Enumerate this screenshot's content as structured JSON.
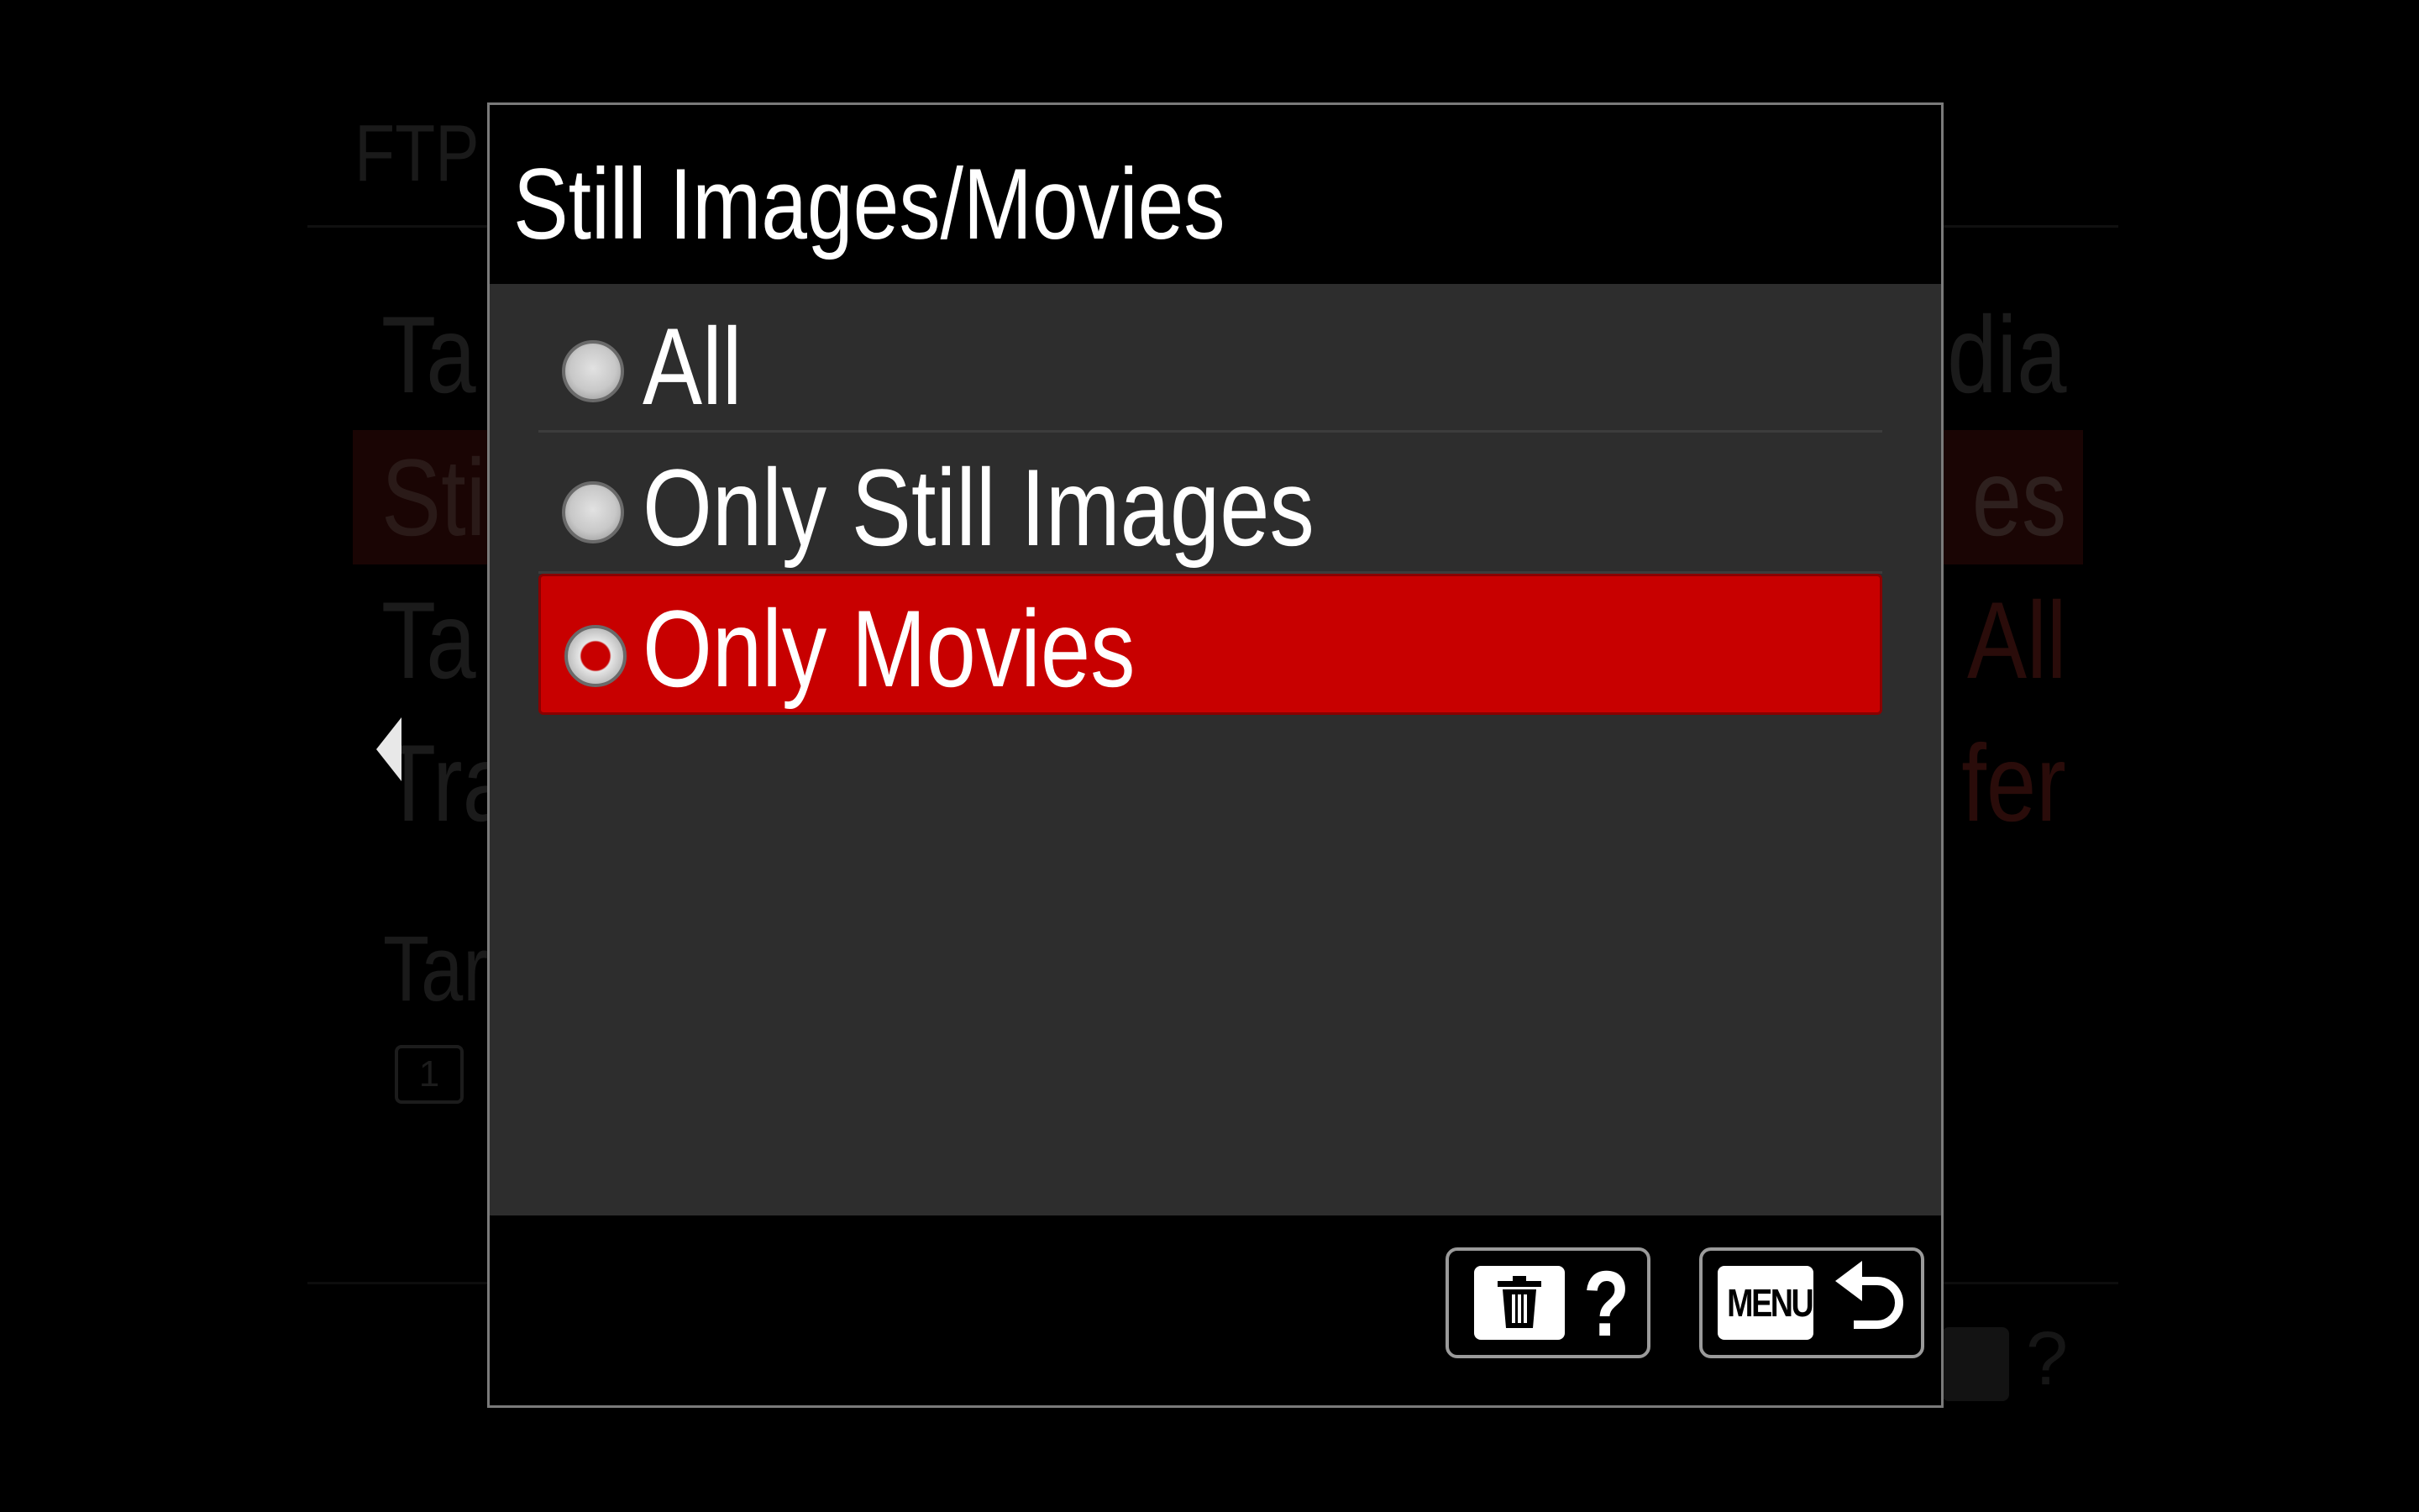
{
  "background_menu": {
    "title": "FTP",
    "rows": [
      {
        "left": "Ta",
        "right": "dia"
      },
      {
        "left": "Sti",
        "right": "es"
      },
      {
        "left": "Ta",
        "right": "All"
      },
      {
        "left": "Tra",
        "right": "fer"
      }
    ],
    "sub_label": "Tar",
    "card_icon_text": "1",
    "help_text": "?"
  },
  "dialog": {
    "title": "Still Images/Movies",
    "options": [
      {
        "label": "All",
        "selected": false
      },
      {
        "label": "Only Still Images",
        "selected": false
      },
      {
        "label": "Only Movies",
        "selected": true
      }
    ],
    "footer": {
      "delete_help_icon": "trash-icon",
      "help_label": "?",
      "menu_label": "MENU",
      "back_icon": "return-arrow-icon"
    }
  },
  "colors": {
    "selection": "#c80000",
    "dialog_bg": "#2d2d2d",
    "header_bg": "#000000",
    "text": "#ffffff"
  }
}
